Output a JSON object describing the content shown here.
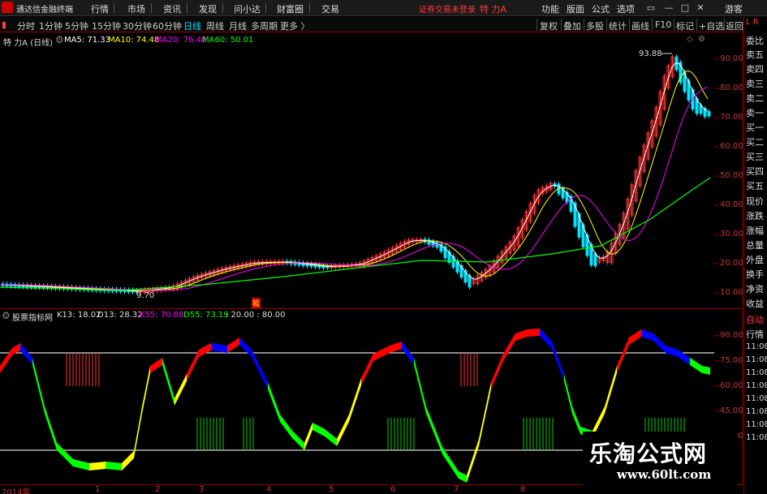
{
  "menubar": {
    "app_title": "通达信金融终端",
    "items": [
      "行情",
      "市场",
      "资讯",
      "发现",
      "问小达",
      "财富圈",
      "交易"
    ],
    "notice": "证券交易未登录",
    "stock_name": "特 力A",
    "right_items": [
      "功能",
      "版面",
      "公式",
      "选项"
    ],
    "user": "游客"
  },
  "periods": {
    "items": [
      "分时",
      "1分钟",
      "5分钟",
      "15分钟",
      "30分钟",
      "60分钟",
      "日线",
      "周线",
      "月线",
      "多周期",
      "更多 〉"
    ],
    "active": "日线"
  },
  "tools": [
    "复权",
    "叠加",
    "多股",
    "统计",
    "画线",
    "F10",
    "标记",
    "+自选",
    "返回"
  ],
  "main_chart": {
    "header": {
      "name": "特 力A (日线)",
      "ma5": "MA5: 71.33",
      "ma10": "MA10: 74.48",
      "ma20": "MA20: 76.48",
      "ma60": "MA60: 50.01"
    },
    "high_label": "93.88",
    "low_label": "9.70",
    "y_ticks": [
      "90.00",
      "80.00",
      "70.00",
      "60.00",
      "50.00",
      "40.00",
      "30.00",
      "20.00",
      "10.00"
    ],
    "marker": "龍"
  },
  "sub_chart": {
    "header": {
      "name": "股票指标网",
      "k13": "K13: 18.02",
      "d13": "D13: 28.32",
      "k55": "K55: 70.88",
      "d55": "D55: 73.19",
      "levels": ": 20.00 : 80.00"
    },
    "y_ticks": [
      "90.00",
      "75.00",
      "60.00",
      "45.00",
      "30.00"
    ]
  },
  "date_axis": [
    "2014年",
    "1",
    "2",
    "3",
    "4",
    "5",
    "6",
    "7",
    "8"
  ],
  "right_panel": {
    "items": [
      "委比",
      "卖五",
      "卖四",
      "卖三",
      "卖二",
      "卖一",
      "买一",
      "买二",
      "买三",
      "买四",
      "买五",
      "现价",
      "涨跌",
      "涨幅",
      "总量",
      "外盘",
      "换手",
      "净资",
      "收益"
    ],
    "lower_items": [
      "自动",
      "行情"
    ],
    "clocks": [
      "11:08",
      "11:08",
      "11:08",
      "11:08",
      "11:08",
      "11:08",
      "11:08",
      "11:08"
    ]
  },
  "watermark": {
    "title": "乐淘公式网",
    "url": "www.60lt.com"
  },
  "colors": {
    "up": "#ff3333",
    "down": "#00e5ff",
    "ma5": "#ffffff",
    "ma10": "#ffff00",
    "ma20": "#ff00ff",
    "ma60": "#00ff00",
    "k13": "#ffff00",
    "d13": "#ff0000",
    "k55": "#0000ff",
    "d55": "#00ff00"
  }
}
